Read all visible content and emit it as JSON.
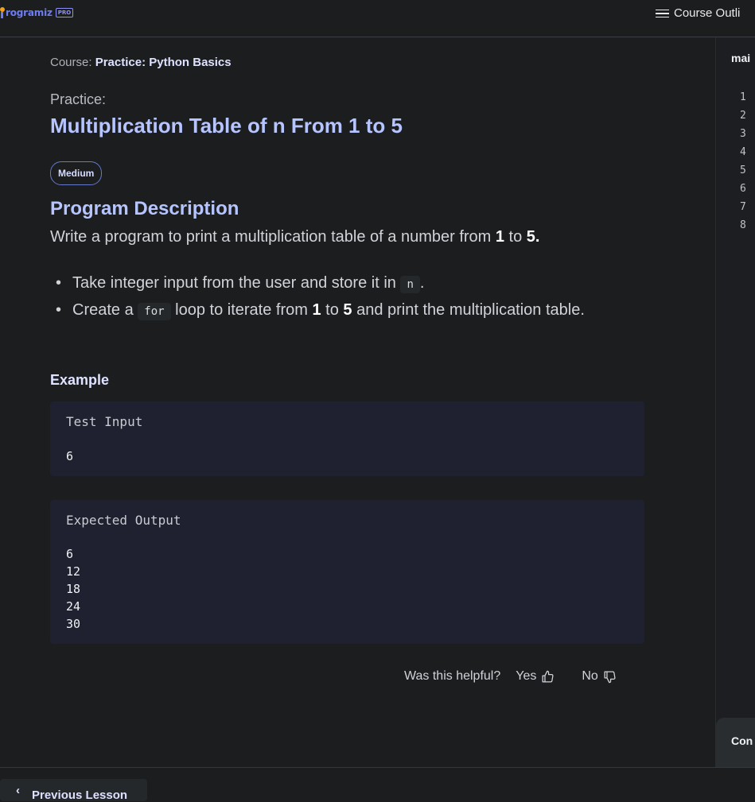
{
  "brand": {
    "name": "rogramiz",
    "badge": "PRO"
  },
  "header": {
    "course_outline": "Course Outli"
  },
  "breadcrumb": {
    "label": "Course:",
    "course": "Practice: Python Basics"
  },
  "lesson": {
    "practice_label": "Practice:",
    "title": "Multiplication Table of n From 1 to 5",
    "difficulty": "Medium"
  },
  "description": {
    "heading": "Program Description",
    "intro_prefix": "Write a program to print a multiplication table of a number from ",
    "intro_from": "1",
    "intro_mid": " to ",
    "intro_to": "5",
    "intro_end": ".",
    "bullet1_text": "Take integer input from the user and store it in",
    "bullet1_code": "n",
    "bullet1_end": ".",
    "bullet2_prefix": "Create a",
    "bullet2_code": "for",
    "bullet2_mid": "loop to iterate from",
    "bullet2_from": "1",
    "bullet2_to_word": "to",
    "bullet2_to": "5",
    "bullet2_end": "and print the multiplication table."
  },
  "example": {
    "heading": "Example",
    "input_title": "Test Input",
    "input_value": "6",
    "output_title": "Expected Output",
    "output_lines": "6\n12\n18\n24\n30"
  },
  "feedback": {
    "question": "Was this helpful?",
    "yes": "Yes",
    "no": "No"
  },
  "editor": {
    "tab": "mai",
    "line_numbers": "1\n2\n3\n4\n5\n6\n7\n8",
    "bottom_label": "Con"
  },
  "footer": {
    "previous": "Previous Lesson"
  },
  "colors": {
    "accent": "#b6c4ff",
    "brand": "#6e7cf2",
    "logo_dot": "#f4a11b"
  }
}
